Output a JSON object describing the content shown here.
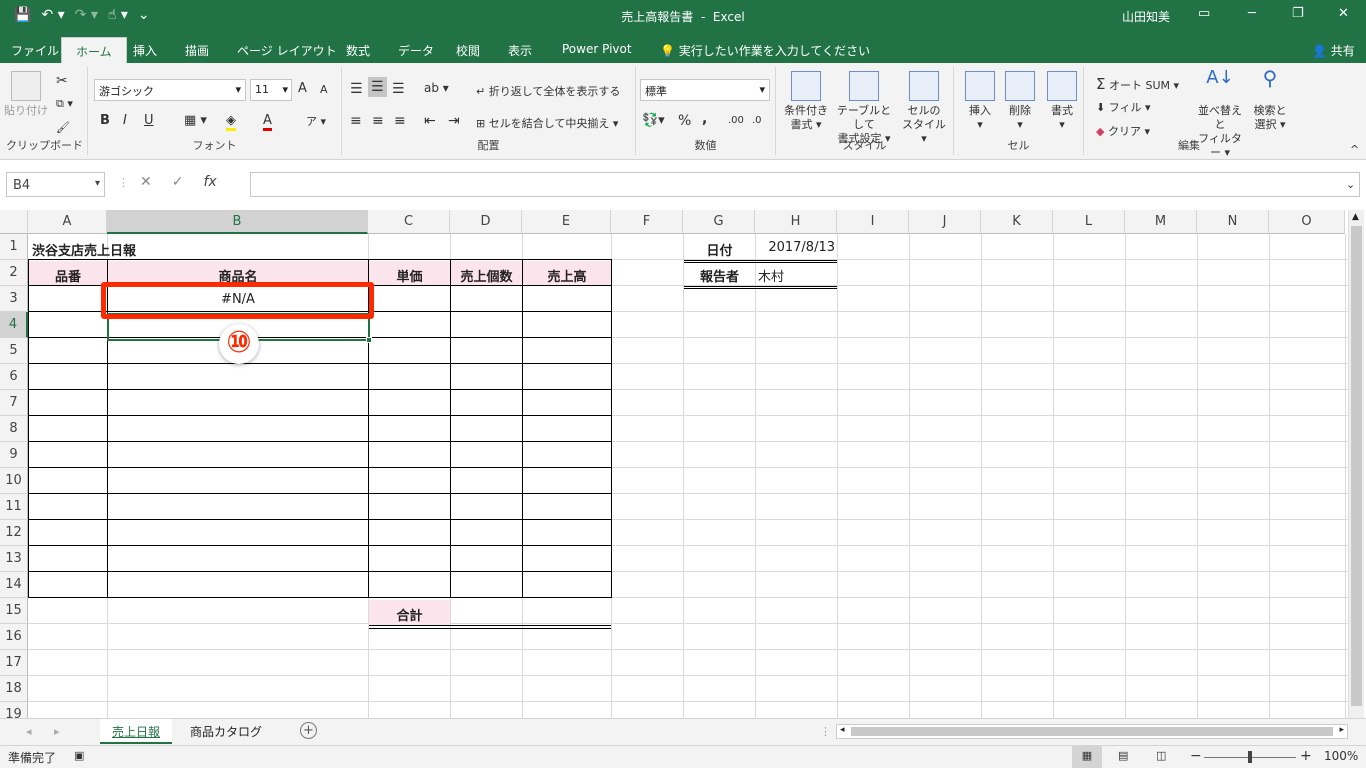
{
  "title": {
    "document": "売上高報告書",
    "sep": "-",
    "app": "Excel",
    "user": "山田知美"
  },
  "ribbon_tabs": [
    "ファイル",
    "ホーム",
    "挿入",
    "描画",
    "ページ レイアウト",
    "数式",
    "データ",
    "校閲",
    "表示",
    "Power Pivot"
  ],
  "tell_me": "実行したい作業を入力してください",
  "share": "共有",
  "ribbon": {
    "clipboard": {
      "paste": "貼り付け",
      "label": "クリップボード"
    },
    "font": {
      "name": "游ゴシック",
      "size": "11",
      "label": "フォント",
      "bold": "B",
      "italic": "I",
      "underline": "U",
      "grow": "A",
      "shrink": "A",
      "color_a": "A"
    },
    "alignment": {
      "wrap": "折り返して全体を表示する",
      "merge": "セルを結合して中央揃え",
      "label": "配置"
    },
    "number": {
      "format": "標準",
      "percent": "%",
      "comma": ",",
      "inc": ".00",
      "dec": ".0",
      "label": "数値"
    },
    "styles": {
      "conditional": [
        "条件付き",
        "書式"
      ],
      "table": [
        "テーブルとして",
        "書式設定"
      ],
      "cell": [
        "セルの",
        "スタイル"
      ],
      "label": "スタイル"
    },
    "cells": {
      "insert": "挿入",
      "delete": "削除",
      "format": "書式",
      "label": "セル"
    },
    "editing": {
      "autosum": "オート SUM",
      "fill": "フィル",
      "clear": "クリア",
      "sort": [
        "並べ替えと",
        "フィルター"
      ],
      "find": [
        "検索と",
        "選択"
      ],
      "label": "編集"
    }
  },
  "formula_bar": {
    "name_box": "B4",
    "fx": "fx",
    "formula": ""
  },
  "columns": [
    "A",
    "B",
    "C",
    "D",
    "E",
    "F",
    "G",
    "H",
    "I",
    "J",
    "K",
    "L",
    "M",
    "N",
    "O"
  ],
  "rows": [
    "1",
    "2",
    "3",
    "4",
    "5",
    "6",
    "7",
    "8",
    "9",
    "10",
    "11",
    "12",
    "13",
    "14",
    "15",
    "16",
    "17",
    "18",
    "19"
  ],
  "selected_cell": "B4",
  "sheet": {
    "title": "渋谷支店売上日報",
    "headers": [
      "品番",
      "商品名",
      "単価",
      "売上個数",
      "売上高"
    ],
    "b3_value": "#N/A",
    "total_label": "合計",
    "date_label": "日付",
    "date_value": "2017/8/13",
    "reporter_label": "報告者",
    "reporter_value": "木村"
  },
  "annotation": {
    "marker": "⑩",
    "color": "#ff2a00"
  },
  "sheet_tabs": [
    "売上日報",
    "商品カタログ"
  ],
  "add_sheet": "+",
  "status": {
    "ready": "準備完了",
    "zoom": "100%"
  },
  "colors": {
    "accent": "#217346",
    "header_fill": "#fce4ec"
  }
}
